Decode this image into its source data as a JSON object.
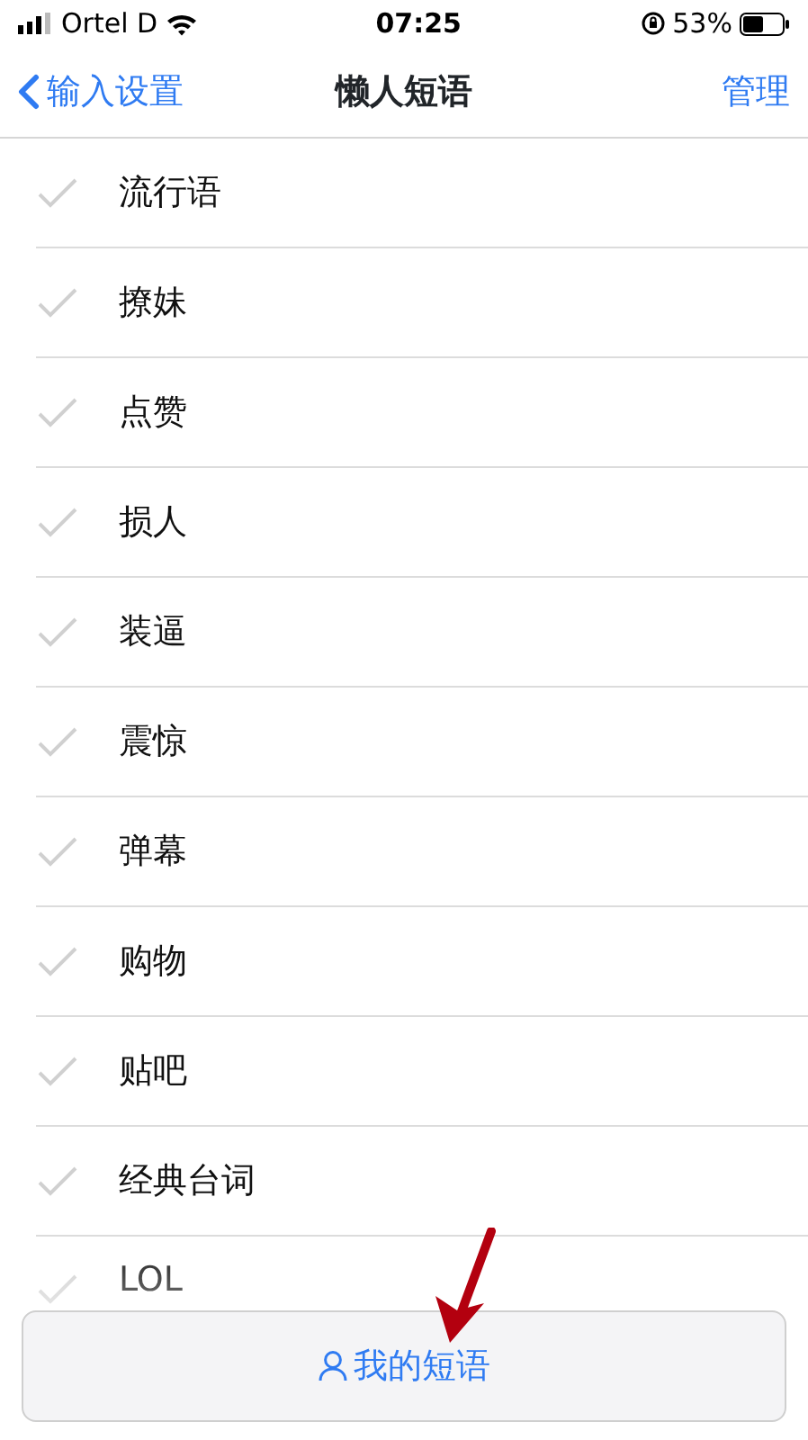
{
  "status_bar": {
    "carrier": "Ortel D",
    "time": "07:25",
    "battery": "53%"
  },
  "nav": {
    "back": "输入设置",
    "title": "懒人短语",
    "action": "管理"
  },
  "items": [
    {
      "label": "流行语",
      "checked": false
    },
    {
      "label": "撩妹",
      "checked": false
    },
    {
      "label": "点赞",
      "checked": false
    },
    {
      "label": "损人",
      "checked": false
    },
    {
      "label": "装逼",
      "checked": false
    },
    {
      "label": "震惊",
      "checked": false
    },
    {
      "label": "弹幕",
      "checked": false
    },
    {
      "label": "购物",
      "checked": false
    },
    {
      "label": "贴吧",
      "checked": false
    },
    {
      "label": "经典台词",
      "checked": false
    },
    {
      "label": "LOL",
      "checked": false
    }
  ],
  "bottom_button": {
    "label": "我的短语"
  }
}
